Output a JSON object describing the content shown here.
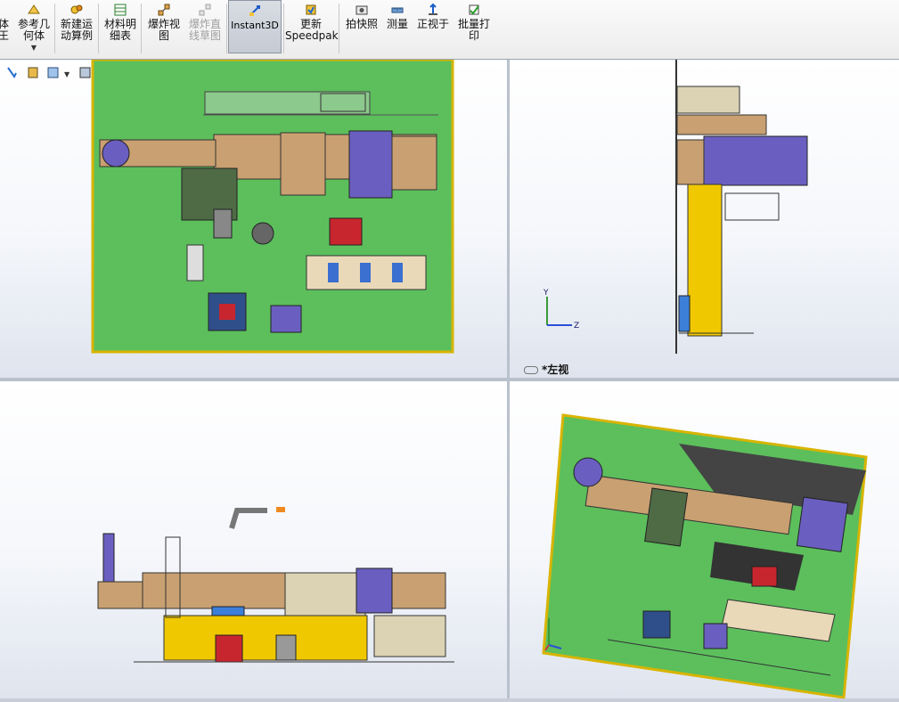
{
  "ribbon": {
    "partial_label": "体\n王",
    "ref_geometry": "参考几\n何体",
    "motion_study": "新建运\n动算例",
    "bom": "材料明\n细表",
    "explode_view": "爆炸视\n图",
    "explode_line": "爆炸直\n线草图",
    "instant3d": "Instant3D",
    "speedpak": "更新\nSpeedpak",
    "snapshot": "拍快照",
    "measure": "测量",
    "normal_to": "正视于",
    "batch_print": "批量打\n印"
  },
  "viewports": {
    "top_right_label": "*左视"
  },
  "triad": {
    "y": "Y",
    "z": "Z"
  },
  "colors": {
    "floor": "#5cbf5c",
    "floor_border": "#d8b400",
    "machine": "#c9a071",
    "hydraulic": "#6a5fc0",
    "guard_yellow": "#f0c800"
  },
  "hud_icons": [
    "select-icon",
    "section-view-icon",
    "view-orientation-icon",
    "display-style-icon",
    "hide-show-icon",
    "appearance-icon",
    "scene-icon",
    "view-settings-icon"
  ]
}
